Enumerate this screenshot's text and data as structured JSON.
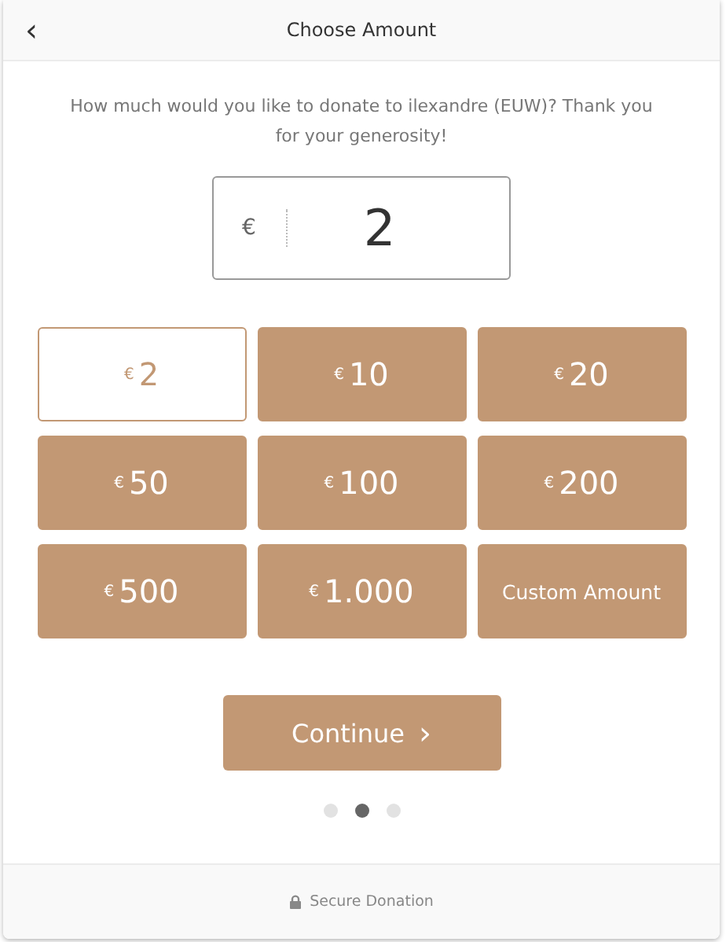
{
  "header": {
    "back": "‹",
    "title": "Choose Amount"
  },
  "prompt": "How much would you like to donate to ilexandre (EUW)? Thank you for your generosity!",
  "amount_field": {
    "currency": "€",
    "value": "2"
  },
  "options": [
    {
      "kind": "amount",
      "currency": "€",
      "value": "2",
      "selected": true
    },
    {
      "kind": "amount",
      "currency": "€",
      "value": "10",
      "selected": false
    },
    {
      "kind": "amount",
      "currency": "€",
      "value": "20",
      "selected": false
    },
    {
      "kind": "amount",
      "currency": "€",
      "value": "50",
      "selected": false
    },
    {
      "kind": "amount",
      "currency": "€",
      "value": "100",
      "selected": false
    },
    {
      "kind": "amount",
      "currency": "€",
      "value": "200",
      "selected": false
    },
    {
      "kind": "amount",
      "currency": "€",
      "value": "500",
      "selected": false
    },
    {
      "kind": "amount",
      "currency": "€",
      "value": "1.000",
      "selected": false
    },
    {
      "kind": "custom",
      "label": "Custom Amount",
      "selected": false
    }
  ],
  "continue_button": {
    "label": "Continue",
    "arrow": "›"
  },
  "steps": [
    {
      "selected": false
    },
    {
      "selected": true
    },
    {
      "selected": false
    }
  ],
  "footer": {
    "label": "Secure Donation"
  }
}
